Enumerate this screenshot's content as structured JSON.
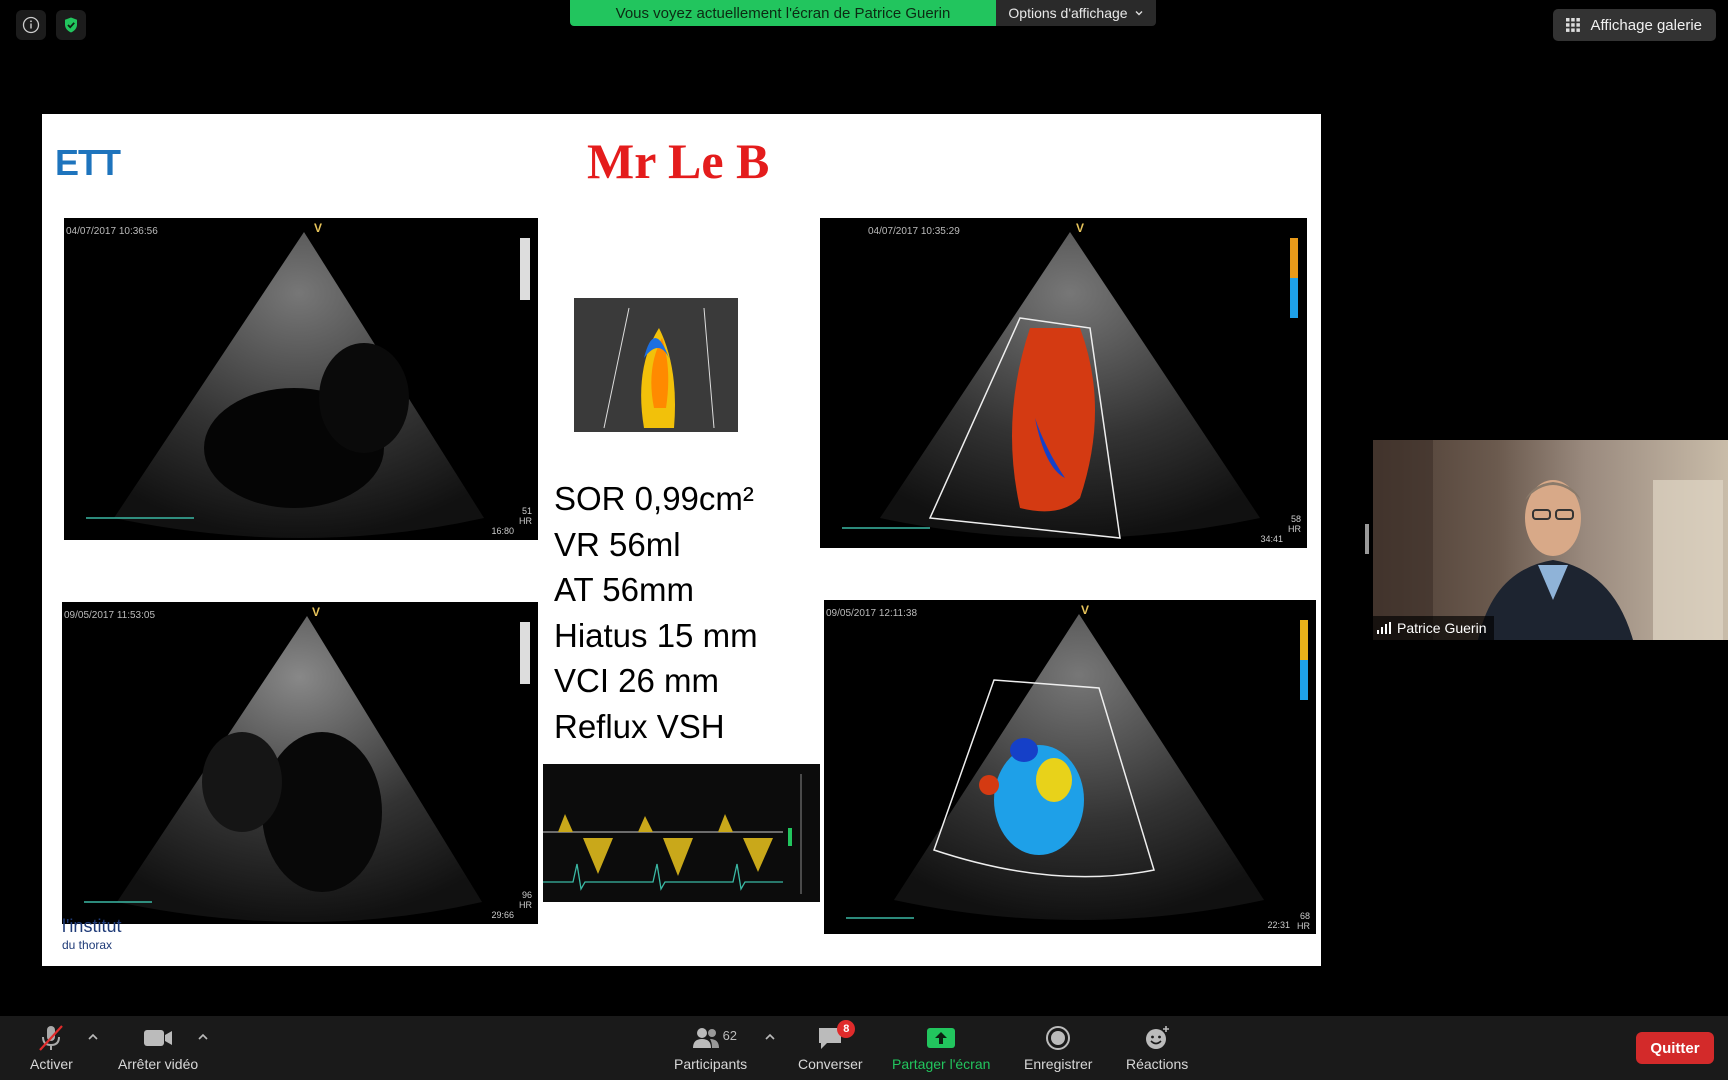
{
  "top": {
    "share_banner": "Vous voyez actuellement l'écran de Patrice Guerin",
    "view_options": "Options d'affichage",
    "gallery_view": "Affichage galerie"
  },
  "slide": {
    "logo": "ETT",
    "title": "Mr Le B",
    "echo_top_left": {
      "timestamp": "04/07/2017 10:36:56",
      "scale": "V",
      "corner": "51\nHR",
      "bottom_right": "16:80"
    },
    "echo_top_right": {
      "timestamp": "04/07/2017 10:35:29",
      "scale": "V",
      "corner": "58\nHR",
      "bottom_right": "34:41"
    },
    "echo_bottom_left": {
      "timestamp": "09/05/2017 11:53:05",
      "scale": "V",
      "corner": "96\nHR",
      "bottom_right": "29:66"
    },
    "echo_bottom_right": {
      "timestamp": "09/05/2017 12:11:38",
      "scale": "V",
      "corner": "68\nHR",
      "bottom_right": "22:31"
    },
    "measurements": [
      "SOR 0,99cm²",
      "VR 56ml",
      "AT 56mm",
      "Hiatus 15 mm",
      "VCI 26 mm",
      "Reflux VSH"
    ],
    "institute_logo_line1": "l'institut",
    "institute_logo_line2": "du thorax"
  },
  "participant": {
    "name": "Patrice Guerin"
  },
  "toolbar": {
    "mute_label": "Activer",
    "video_label": "Arrêter vidéo",
    "participants_label": "Participants",
    "participants_count": "62",
    "chat_label": "Converser",
    "chat_badge": "8",
    "share_label": "Partager l'écran",
    "record_label": "Enregistrer",
    "reactions_label": "Réactions",
    "quit_label": "Quitter"
  },
  "colors": {
    "share_green": "#22c55e",
    "quit_red": "#d32a2a",
    "title_red": "#e41c1c",
    "logo_blue": "#1e74bd"
  }
}
